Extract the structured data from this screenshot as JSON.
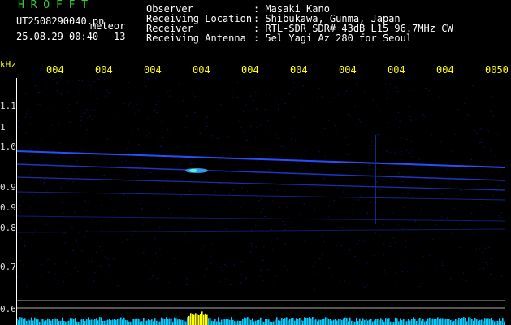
{
  "brand": "H R O F F T",
  "file": {
    "name": "UT2508290040.pn",
    "type": "meteor",
    "datetime": "25.08.29 00:40",
    "count": "13"
  },
  "info": [
    {
      "label": "Observer",
      "value": ": Masaki Kano"
    },
    {
      "label": "Receiving Location",
      "value": ": Shibukawa, Gunma, Japan"
    },
    {
      "label": "Receiver",
      "value": ": RTL-SDR SDR# 43dB L15 96.7MHz CW"
    },
    {
      "label": "Receiving Antenna",
      "value": ": 5el Yagi Az 280 for Seoul"
    }
  ],
  "axis": {
    "freq_unit": "kHz",
    "time_ticks": [
      "004",
      "004",
      "004",
      "004",
      "004",
      "004",
      "004",
      "004",
      "004",
      "0050"
    ],
    "freq_ticks": [
      "1.1",
      "1",
      "1.0",
      "0.9",
      "0.9",
      "0.8",
      "0.7",
      "0.6"
    ]
  },
  "colors": {
    "brand": "#33cc33",
    "text": "#ffffff",
    "tick": "#ffff00",
    "axis_label": "#dddddd",
    "trace": "#2244ff",
    "trace_bright": "#66aaff",
    "background_noise": "#000044",
    "meter_cyan": "#00ccff",
    "meter_yellow": "#ffff00"
  }
}
